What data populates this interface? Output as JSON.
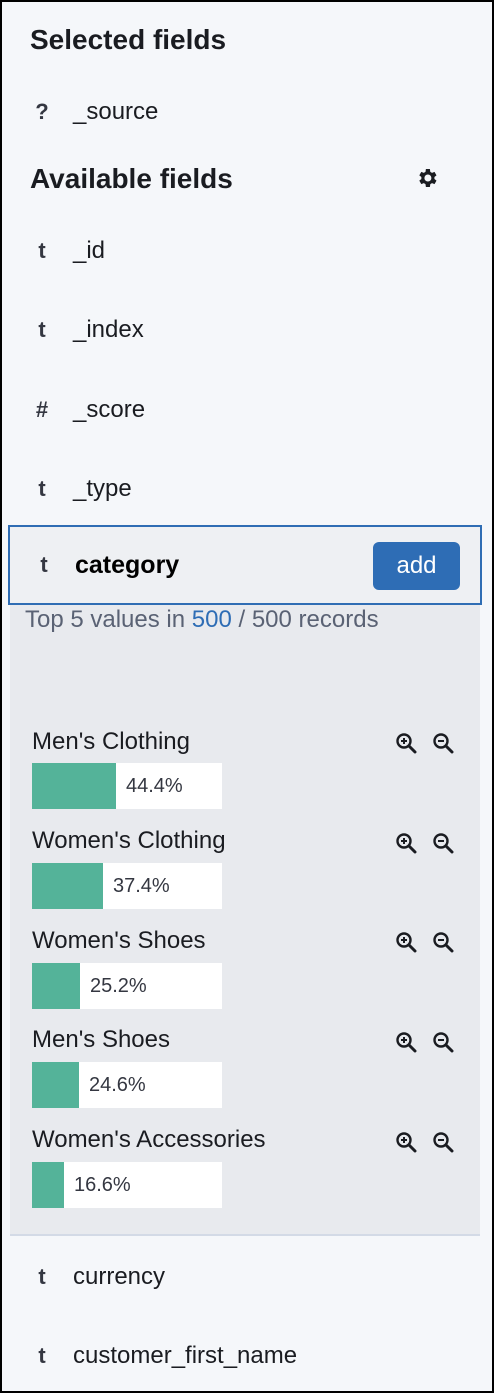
{
  "selected_section": {
    "title": "Selected fields",
    "fields": [
      {
        "type": "?",
        "name": "_source"
      }
    ]
  },
  "available_section": {
    "title": "Available fields",
    "settings_icon": "gear-icon",
    "fields": [
      {
        "type": "t",
        "name": "_id"
      },
      {
        "type": "t",
        "name": "_index"
      },
      {
        "type": "#",
        "name": "_score"
      },
      {
        "type": "t",
        "name": "_type"
      }
    ],
    "expanded_field": {
      "type": "t",
      "name": "category",
      "add_label": "add",
      "summary_prefix": "Top 5 values in",
      "summary_count": "500",
      "summary_total": "/ 500 records",
      "values": [
        {
          "label": "Men's Clothing",
          "percent_text": "44.4%",
          "fraction": 0.444
        },
        {
          "label": "Women's Clothing",
          "percent_text": "37.4%",
          "fraction": 0.374
        },
        {
          "label": "Women's Shoes",
          "percent_text": "25.2%",
          "fraction": 0.252
        },
        {
          "label": "Men's Shoes",
          "percent_text": "24.6%",
          "fraction": 0.246
        },
        {
          "label": "Women's Accessories",
          "percent_text": "16.6%",
          "fraction": 0.166
        }
      ]
    },
    "more_fields": [
      {
        "type": "t",
        "name": "currency"
      },
      {
        "type": "t",
        "name": "customer_first_name"
      }
    ]
  },
  "colors": {
    "accent": "#2e6db5",
    "bar": "#54b399",
    "panel": "#f5f7fa"
  },
  "icons": {
    "filter_for": "zoom-in-icon",
    "filter_out": "zoom-out-icon"
  }
}
